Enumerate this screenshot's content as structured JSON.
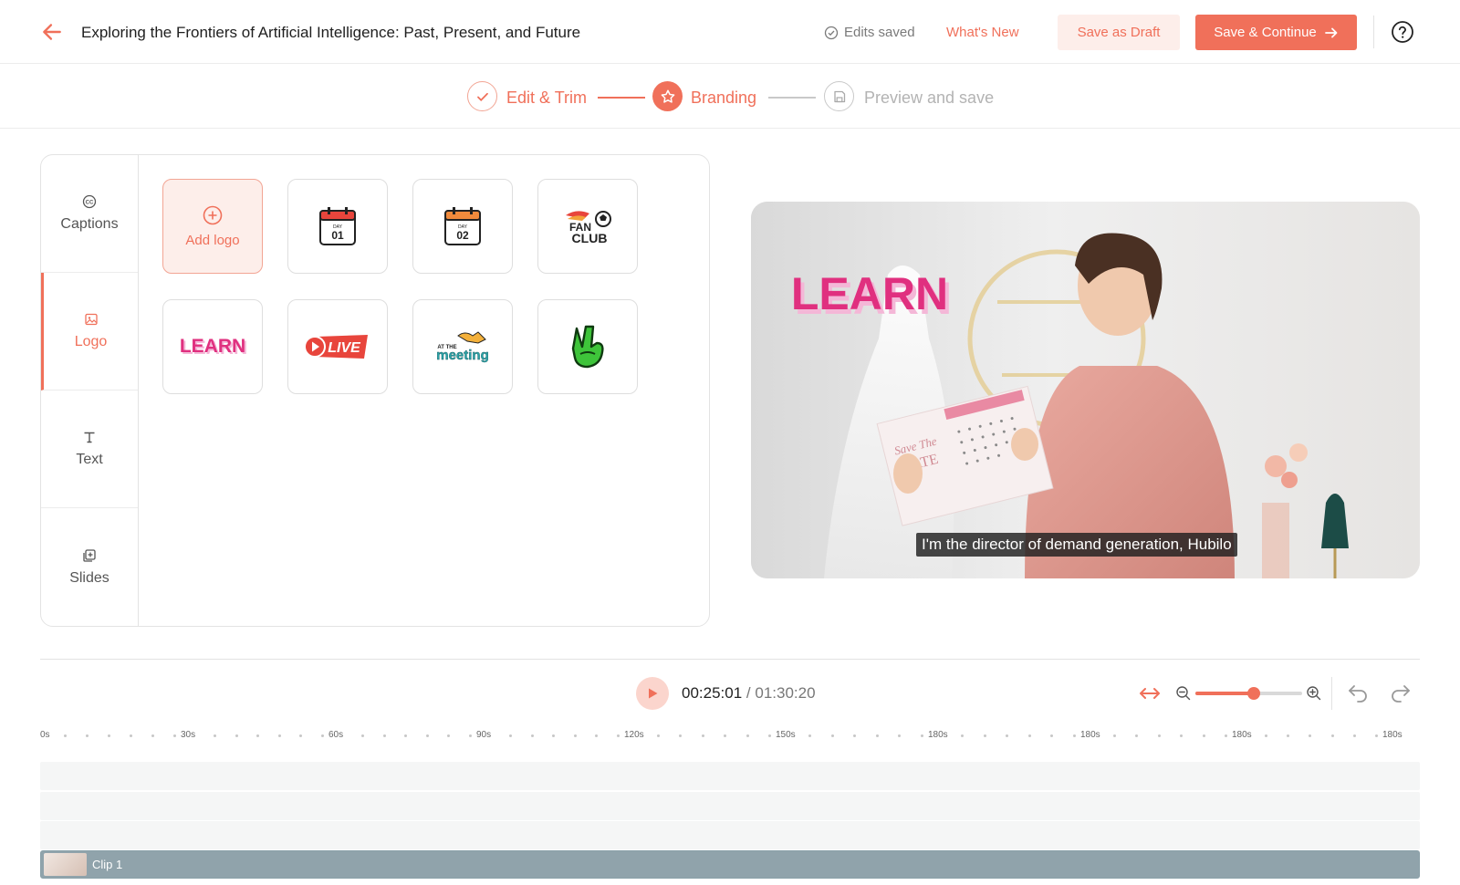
{
  "header": {
    "title": "Exploring the Frontiers of Artificial Intelligence: Past, Present, and Future",
    "edits_saved": "Edits saved",
    "whats_new": "What's New",
    "save_draft": "Save as Draft",
    "save_continue": "Save & Continue"
  },
  "stepper": {
    "steps": [
      {
        "label": "Edit & Trim",
        "state": "done"
      },
      {
        "label": "Branding",
        "state": "active"
      },
      {
        "label": "Preview and save",
        "state": "pending"
      }
    ]
  },
  "sidebar": {
    "items": [
      {
        "label": "Captions",
        "icon": "cc-icon"
      },
      {
        "label": "Logo",
        "icon": "image-icon",
        "active": true
      },
      {
        "label": "Text",
        "icon": "text-icon"
      },
      {
        "label": "Slides",
        "icon": "slides-icon"
      }
    ]
  },
  "logos": {
    "add_label": "Add logo",
    "items": [
      {
        "name": "day-01-calendar",
        "line1": "DAY",
        "line2": "01",
        "color": "#e8453c"
      },
      {
        "name": "day-02-calendar",
        "line1": "DAY",
        "line2": "02",
        "color": "#f08a3c"
      },
      {
        "name": "fan-club",
        "line1": "FAN",
        "line2": "CLUB"
      },
      {
        "name": "learn",
        "text": "LEARN"
      },
      {
        "name": "live",
        "text": "LIVE"
      },
      {
        "name": "at-the-meeting",
        "line1": "AT THE",
        "line2": "meeting"
      },
      {
        "name": "peace-hand",
        "text": ""
      }
    ]
  },
  "preview": {
    "caption": "I'm the director of demand generation, Hubilo",
    "overlay_logo": "LEARN",
    "card_title1": "Save The",
    "card_title2": "DATE"
  },
  "timeline": {
    "current_time": "00:25:01",
    "separator": " / ",
    "total_time": "01:30:20",
    "zoom_level": 0.55,
    "ticks": [
      "0s",
      "30s",
      "60s",
      "90s",
      "120s",
      "150s",
      "180s",
      "180s",
      "180s",
      "180s"
    ],
    "clip_label": "Clip 1"
  },
  "colors": {
    "accent": "#f0705a",
    "accent_light": "#fdeeea",
    "clip": "#90a3ab"
  }
}
